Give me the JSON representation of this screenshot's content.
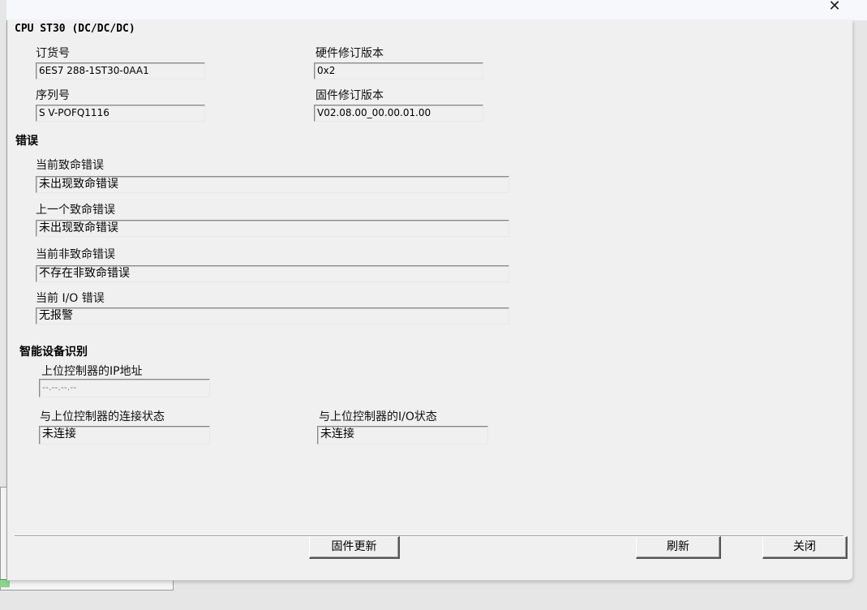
{
  "device": {
    "title": "CPU ST30 (DC/DC/DC)",
    "order_label": "订货号",
    "order_value": "6ES7 288-1ST30-0AA1",
    "hw_rev_label": "硬件修订版本",
    "hw_rev_value": "0x2",
    "serial_label": "序列号",
    "serial_value": "S V-POFQ1116",
    "fw_rev_label": "固件修订版本",
    "fw_rev_value": "V02.08.00_00.00.01.00"
  },
  "errors": {
    "title": "错误",
    "current_fatal_label": "当前致命错误",
    "current_fatal_value": "未出现致命错误",
    "last_fatal_label": "上一个致命错误",
    "last_fatal_value": "未出现致命错误",
    "current_nonfatal_label": "当前非致命错误",
    "current_nonfatal_value": "不存在非致命错误",
    "current_io_label": "当前 I/O 错误",
    "current_io_value": "无报警"
  },
  "smart_device": {
    "title": "智能设备识别",
    "controller_ip_label": "上位控制器的IP地址",
    "controller_ip_value": "--.--.--.--",
    "connection_label": "与上位控制器的连接状态",
    "connection_value": "未连接",
    "io_status_label": "与上位控制器的I/O状态",
    "io_status_value": "未连接"
  },
  "buttons": {
    "firmware_update": "固件更新",
    "refresh": "刷新",
    "close": "关闭"
  },
  "window": {
    "close_glyph": "✕"
  }
}
